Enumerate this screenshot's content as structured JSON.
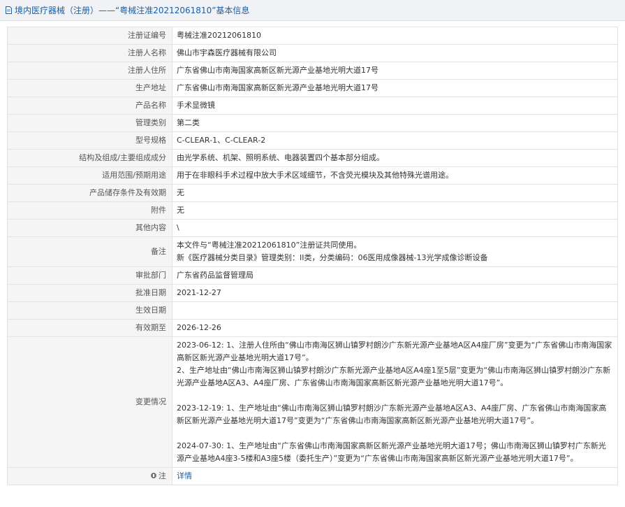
{
  "header": {
    "title": "境内医疗器械（注册）——“粤械注准20212061810”基本信息",
    "icon": "document-icon"
  },
  "rows": [
    {
      "label": "注册证编号",
      "value": "粤械注准20212061810"
    },
    {
      "label": "注册人名称",
      "value": "佛山市宇森医疗器械有限公司"
    },
    {
      "label": "注册人住所",
      "value": "广东省佛山市南海国家高新区新光源产业基地光明大道17号"
    },
    {
      "label": "生产地址",
      "value": "广东省佛山市南海国家高新区新光源产业基地光明大道17号"
    },
    {
      "label": "产品名称",
      "value": "手术显微镜"
    },
    {
      "label": "管理类别",
      "value": "第二类"
    },
    {
      "label": "型号规格",
      "value": "C-CLEAR-1、C-CLEAR-2"
    },
    {
      "label": "结构及组成/主要组成成分",
      "value": "由光学系统、机架、照明系统、电器装置四个基本部分组成。"
    },
    {
      "label": "适用范围/预期用途",
      "value": "用于在非眼科手术过程中放大手术区域细节，不含荧光模块及其他特殊光谱用途。"
    },
    {
      "label": "产品储存条件及有效期",
      "value": "无"
    },
    {
      "label": "附件",
      "value": "无"
    },
    {
      "label": "其他内容",
      "value": "\\"
    }
  ],
  "remark": {
    "label": "备注",
    "line1": "本文件与“粤械注准20212061810”注册证共同使用。",
    "line2": "新《医疗器械分类目录》管理类别：II类，分类编码：06医用成像器械-13光学成像诊断设备"
  },
  "rows2": [
    {
      "label": "审批部门",
      "value": "广东省药品监督管理局"
    },
    {
      "label": "批准日期",
      "value": "2021-12-27"
    },
    {
      "label": "生效日期",
      "value": ""
    },
    {
      "label": "有效期至",
      "value": "2026-12-26"
    }
  ],
  "changes": {
    "label": "变更情况",
    "entry1": "2023-06-12: 1、注册人住所由“佛山市南海区狮山镇罗村朗沙广东新光源产业基地A区A4座厂房”变更为“广东省佛山市南海国家高新区新光源产业基地光明大道17号”。\n2、生产地址由“佛山市南海区狮山镇罗村朗沙广东新光源产业基地A区A4座1至5层”变更为“佛山市南海区狮山镇罗村朗沙广东新光源产业基地A区A3、A4座厂房、广东省佛山市南海国家高新区新光源产业基地光明大道17号”。",
    "entry2": "2023-12-19: 1、生产地址由“佛山市南海区狮山镇罗村朗沙广东新光源产业基地A区A3、A4座厂房、广东省佛山市南海国家高新区新光源产业基地光明大道17号”变更为“广东省佛山市南海国家高新区新光源产业基地光明大道17号”。",
    "entry3": "2024-07-30: 1、生产地址由“广东省佛山市南海国家高新区新光源产业基地光明大道17号；佛山市南海区狮山镇罗村广东新光源产业基地A4座3-5楼和A3座5楼（委托生产）”变更为“广东省佛山市南海国家高新区新光源产业基地光明大道17号”。"
  },
  "note": {
    "label": "注",
    "link": "详情",
    "icon": "info-icon"
  }
}
